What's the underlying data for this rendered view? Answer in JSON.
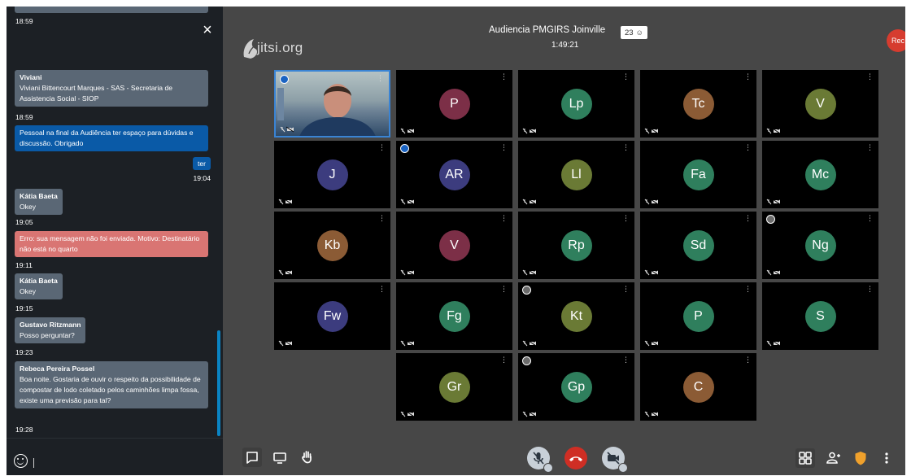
{
  "chat": {
    "close_label": "×",
    "messages": [
      {
        "name": "Viviani",
        "text": "Viviani Bittencourt Marques - SAS - Secretaria de Assistencia Social - SIOP",
        "time": "18:59",
        "first_time": "18:59"
      },
      {
        "text": "Pessoal na final da Audiência ter espaço para dúvidas e discussão. Obrigado"
      },
      {
        "text": "ter",
        "time": "19:04"
      },
      {
        "name": "Kátia Baeta",
        "text": "Okey",
        "time": "19:05"
      },
      {
        "text": "Erro: sua mensagem não foi enviada. Motivo: Destinatário não está no quarto",
        "time": "19:11"
      },
      {
        "name": "Kátia Baeta",
        "text": "Okey",
        "time": "19:15"
      },
      {
        "name": "Gustavo Ritzmann",
        "text": "Posso perguntar?",
        "time": "19:23"
      },
      {
        "name": "Rebeca Pereira Possel",
        "text": "Boa noite. Gostaria de ouvir o respeito da possibilidade de compostar de lodo coletado pelos caminhões limpa fossa, existe uma previsão para tal?",
        "time": "19:28"
      }
    ]
  },
  "header": {
    "logo_text": "jitsi.org",
    "meeting_title": "Audiencia PMGIRS Joinville",
    "participant_count": "23",
    "timer": "1:49:21",
    "rec_label": "Rec"
  },
  "tiles": [
    {
      "initials": "",
      "color": "#000000",
      "video": true
    },
    {
      "initials": "P",
      "color": "#7c2f47"
    },
    {
      "initials": "Lp",
      "color": "#2f7f5d"
    },
    {
      "initials": "Tc",
      "color": "#8b5b35"
    },
    {
      "initials": "V",
      "color": "#6a7a35"
    },
    {
      "initials": "J",
      "color": "#3c3c7e"
    },
    {
      "initials": "AR",
      "color": "#3c3c7e"
    },
    {
      "initials": "Ll",
      "color": "#6a7a35"
    },
    {
      "initials": "Fa",
      "color": "#2f7f5d"
    },
    {
      "initials": "Mc",
      "color": "#2f7f5d"
    },
    {
      "initials": "Kb",
      "color": "#8b5b35"
    },
    {
      "initials": "V",
      "color": "#7c2f47"
    },
    {
      "initials": "Rp",
      "color": "#2f7f5d"
    },
    {
      "initials": "Sd",
      "color": "#2f7f5d"
    },
    {
      "initials": "Ng",
      "color": "#2f7f5d"
    },
    {
      "initials": "Fw",
      "color": "#3c3c7e"
    },
    {
      "initials": "Fg",
      "color": "#2f7f5d"
    },
    {
      "initials": "Kt",
      "color": "#6a7a35"
    },
    {
      "initials": "P",
      "color": "#2f7f5d"
    },
    {
      "initials": "S",
      "color": "#2f7f5d"
    },
    {
      "initials": "Gr",
      "color": "#6a7a35"
    },
    {
      "initials": "Gp",
      "color": "#2f7f5d"
    },
    {
      "initials": "C",
      "color": "#8b5b35"
    }
  ],
  "colors": {
    "accent": "#3a84d4",
    "hangup": "#cf2e24",
    "chat_bubble": "#5a6775",
    "chat_error": "#d97573",
    "chat_mine": "#0a5aa7",
    "rec": "#d63c2f"
  },
  "icons": {
    "logo": "jitsi-logo-icon",
    "chat_toggle": "chat-icon",
    "screenshare": "desktop-icon",
    "raise_hand": "hand-icon",
    "mic": "mic-muted-icon",
    "hangup": "phone-hangup-icon",
    "camera": "camera-off-icon",
    "tile_view": "grid-icon",
    "invite": "add-people-icon",
    "security": "shield-icon",
    "more": "more-vertical-icon"
  }
}
